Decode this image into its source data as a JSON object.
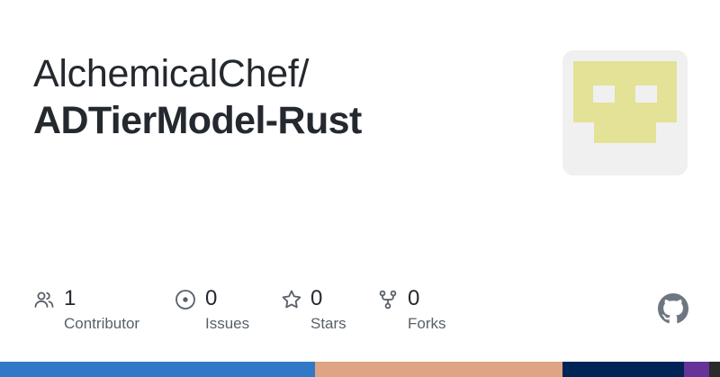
{
  "header": {
    "owner": "AlchemicalChef/",
    "repo_name": "ADTierModel-Rust"
  },
  "avatar": {
    "color": "#e3e296",
    "background": "#f0f0f0"
  },
  "stats": {
    "contributors": {
      "count": "1",
      "label": "Contributor",
      "icon": "people-icon"
    },
    "issues": {
      "count": "0",
      "label": "Issues",
      "icon": "issue-opened-icon"
    },
    "stars": {
      "count": "0",
      "label": "Stars",
      "icon": "star-icon"
    },
    "forks": {
      "count": "0",
      "label": "Forks",
      "icon": "repo-forked-icon"
    }
  },
  "language_bar": [
    {
      "color": "#3178c6",
      "fraction": 0.438
    },
    {
      "color": "#dea584",
      "fraction": 0.343
    },
    {
      "color": "#012456",
      "fraction": 0.169
    },
    {
      "color": "#663399",
      "fraction": 0.035
    },
    {
      "color": "#2b2b2b",
      "fraction": 0.015
    }
  ]
}
